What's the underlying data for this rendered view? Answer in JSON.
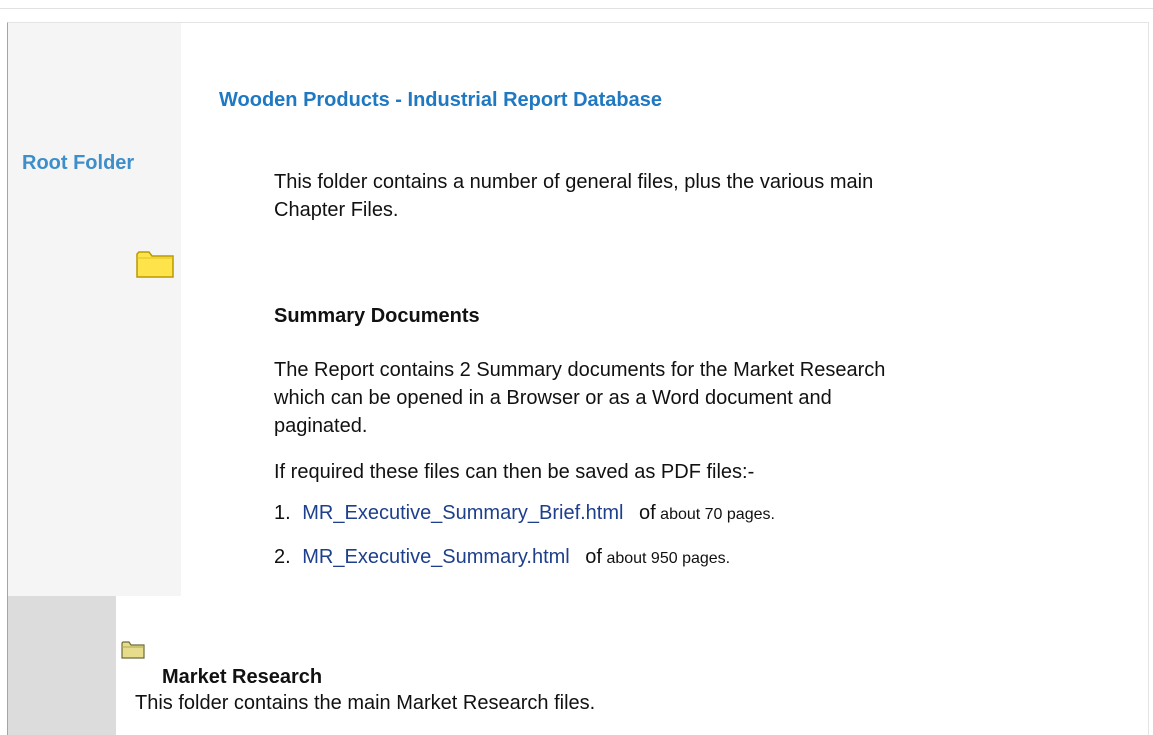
{
  "header": {
    "title": "Wooden Products - Industrial Report Database"
  },
  "sidebar": {
    "root_folder_label": "Root Folder",
    "folder_icon": "folder-icon"
  },
  "intro": {
    "text": "This folder contains a number of general files, plus the various main Chapter Files."
  },
  "summary": {
    "heading": "Summary Documents",
    "description": "The Report contains 2 Summary documents for the Market Research which can be opened in a Browser or as a Word document and paginated.",
    "pdf_note": "If required these files can then be saved as PDF files:-",
    "files": [
      {
        "number": "1.",
        "name": "MR_Executive_Summary_Brief.html",
        "of_word": "of",
        "suffix": "about 70 pages."
      },
      {
        "number": "2.",
        "name": "MR_Executive_Summary.html",
        "of_word": "of",
        "suffix": "about 950 pages."
      }
    ]
  },
  "market_research": {
    "heading": "Market Research",
    "description": "This folder contains the main Market Research files.",
    "icon": "folder-icon"
  },
  "colors": {
    "sidebar_label": "#3d8ec9",
    "title": "#1f78c2",
    "link": "#1d3f8c",
    "folder_fill": "#ffe34a",
    "folder_stroke": "#b89a00"
  }
}
